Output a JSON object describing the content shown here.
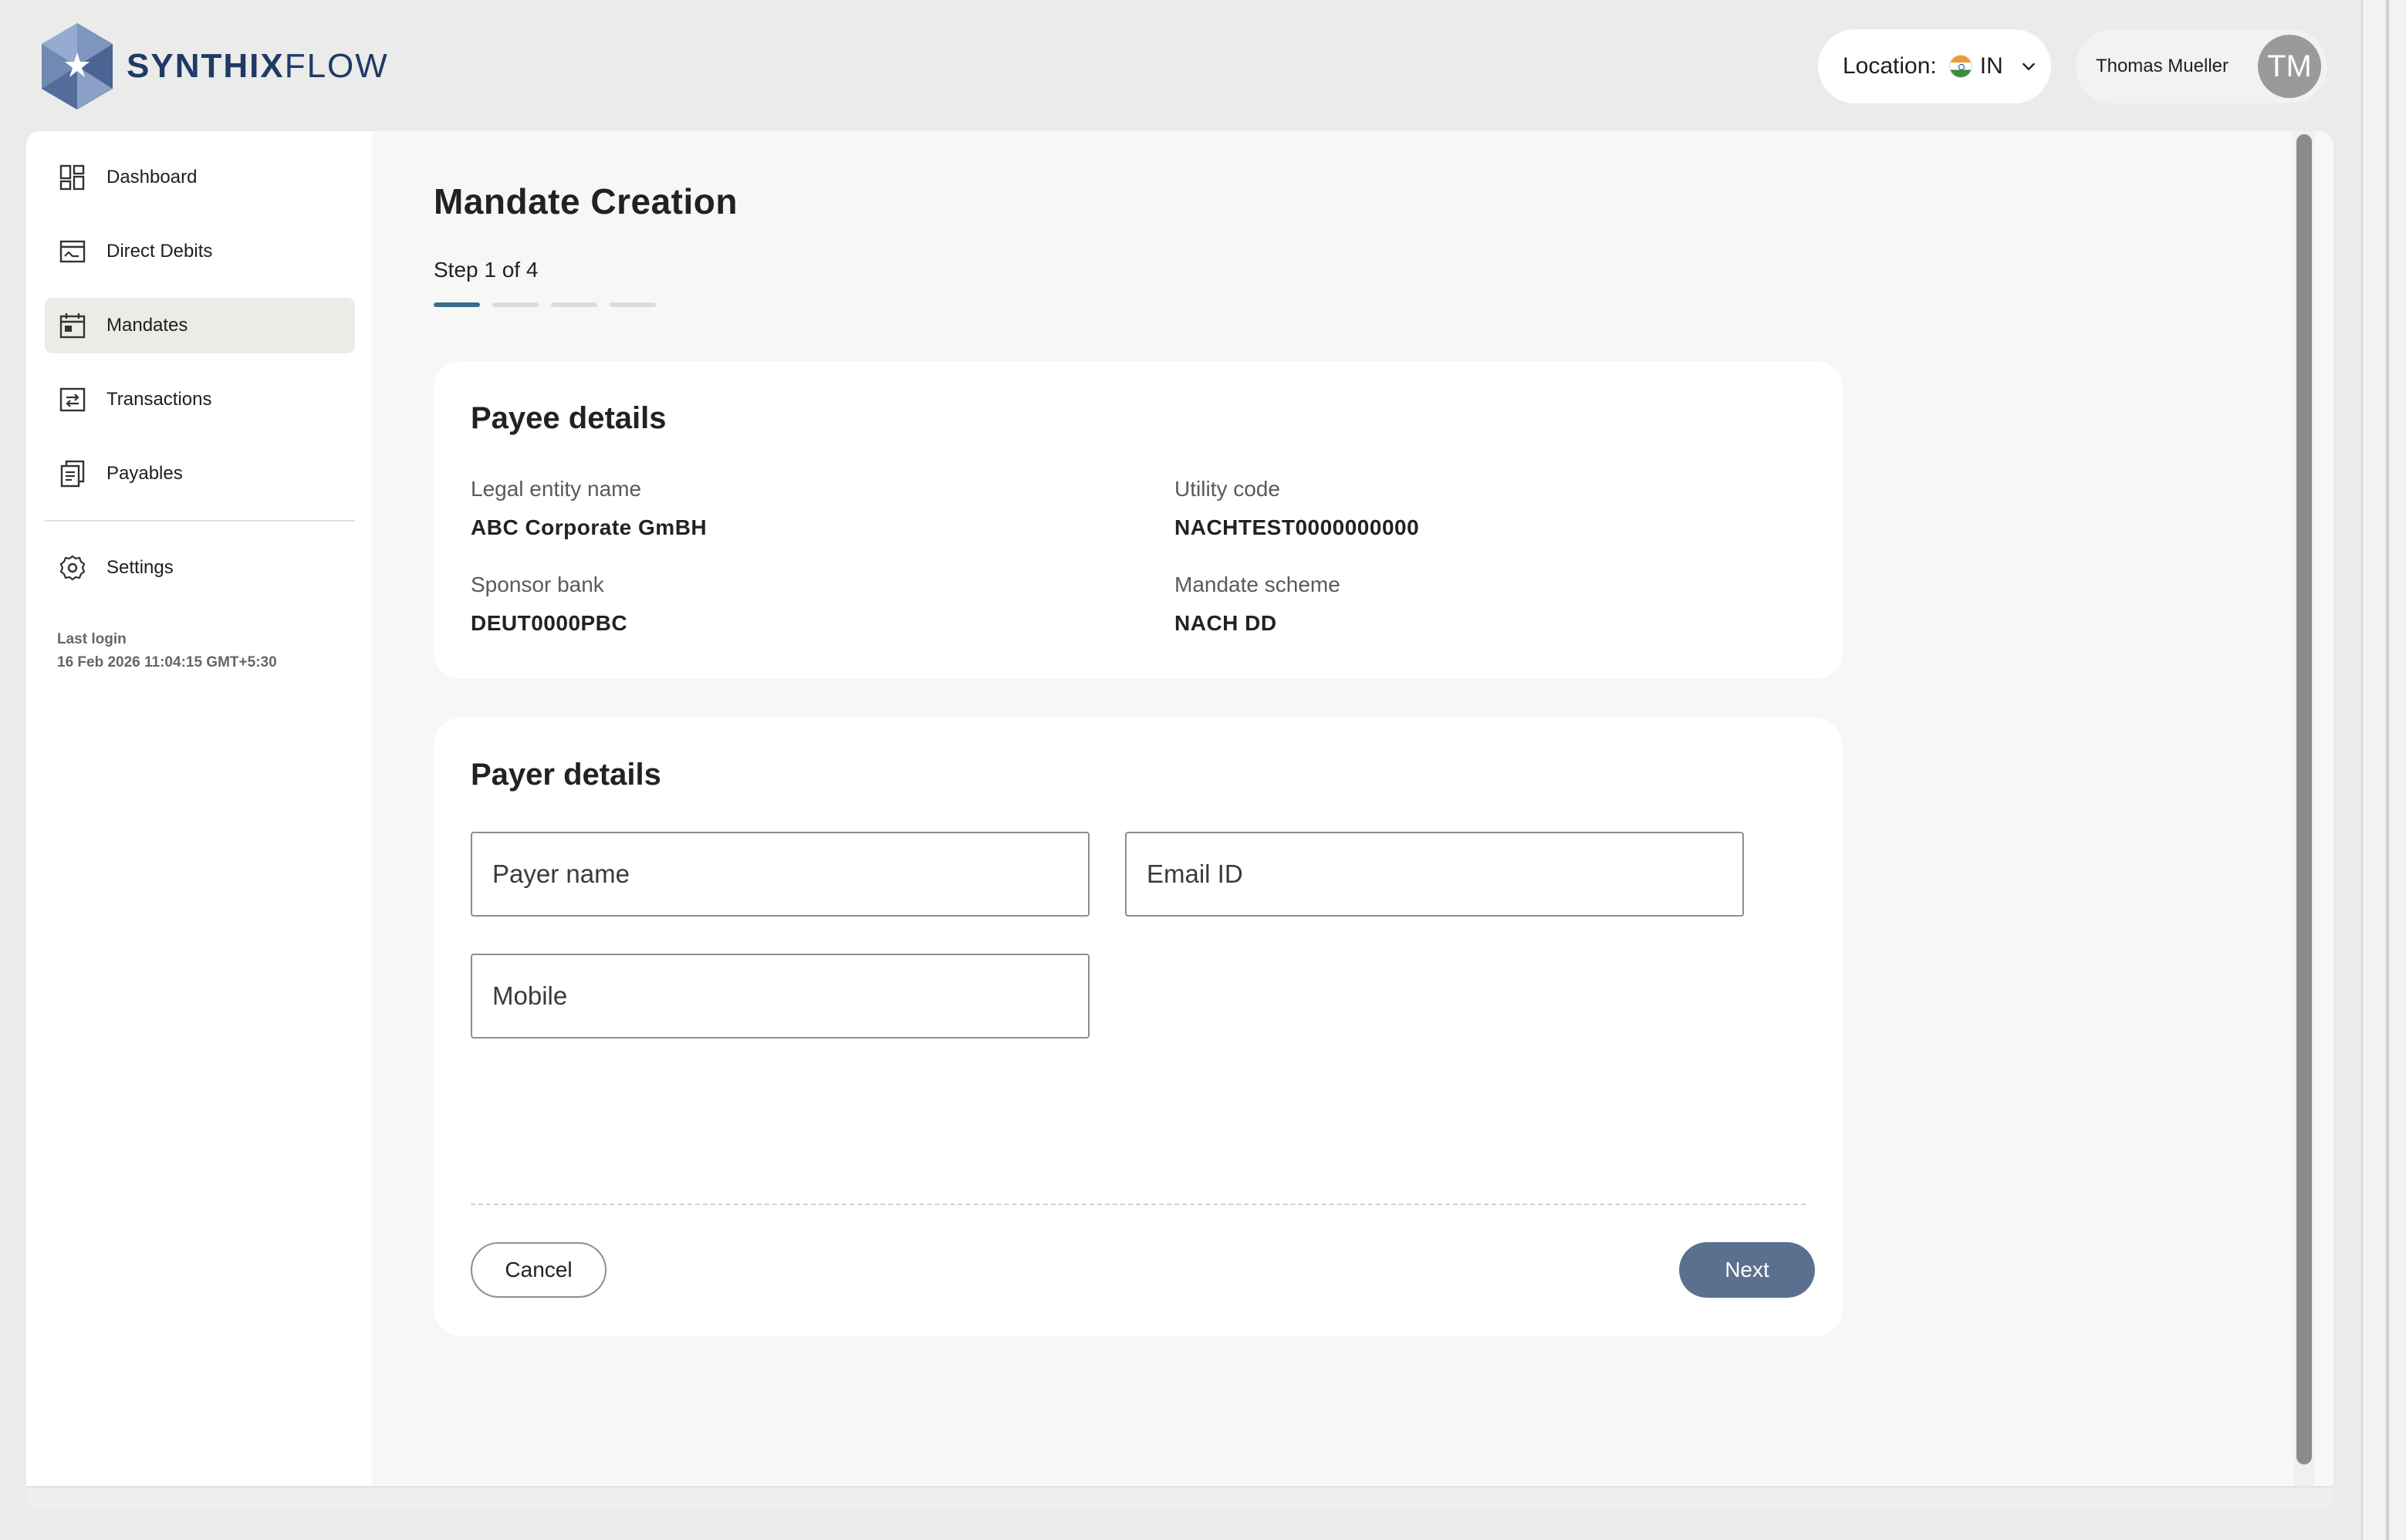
{
  "brand": {
    "name_bold": "SYNTHIX",
    "name_light": "FLOW"
  },
  "header": {
    "location_label": "Location:",
    "location_value": "IN",
    "user_name": "Thomas Mueller",
    "avatar_initials": "TM"
  },
  "sidebar": {
    "items": [
      {
        "label": "Dashboard",
        "icon": "dashboard-icon"
      },
      {
        "label": "Direct Debits",
        "icon": "direct-debits-icon"
      },
      {
        "label": "Mandates",
        "icon": "calendar-icon",
        "active": true
      },
      {
        "label": "Transactions",
        "icon": "transactions-icon"
      },
      {
        "label": "Payables",
        "icon": "payables-icon"
      }
    ],
    "settings_label": "Settings",
    "last_login_label": "Last login",
    "last_login_value": "16 Feb 2026 11:04:15 GMT+5:30"
  },
  "page": {
    "title": "Mandate Creation",
    "step_text": "Step 1 of 4",
    "current_step": 1,
    "total_steps": 4
  },
  "payee": {
    "title": "Payee details",
    "legal_entity_label": "Legal entity name",
    "legal_entity_value": "ABC Corporate GmBH",
    "utility_code_label": "Utility code",
    "utility_code_value": "NACHTEST0000000000",
    "sponsor_bank_label": "Sponsor bank",
    "sponsor_bank_value": "DEUT0000PBC",
    "mandate_scheme_label": "Mandate scheme",
    "mandate_scheme_value": "NACH DD"
  },
  "payer": {
    "title": "Payer details",
    "payer_name_placeholder": "Payer name",
    "email_placeholder": "Email ID",
    "mobile_placeholder": "Mobile",
    "cancel_label": "Cancel",
    "next_label": "Next"
  },
  "colors": {
    "brand": "#1f3a68",
    "accent_step": "#3b6c8c",
    "next_button": "#5b6f8f",
    "active_nav": "#ecebe8"
  }
}
